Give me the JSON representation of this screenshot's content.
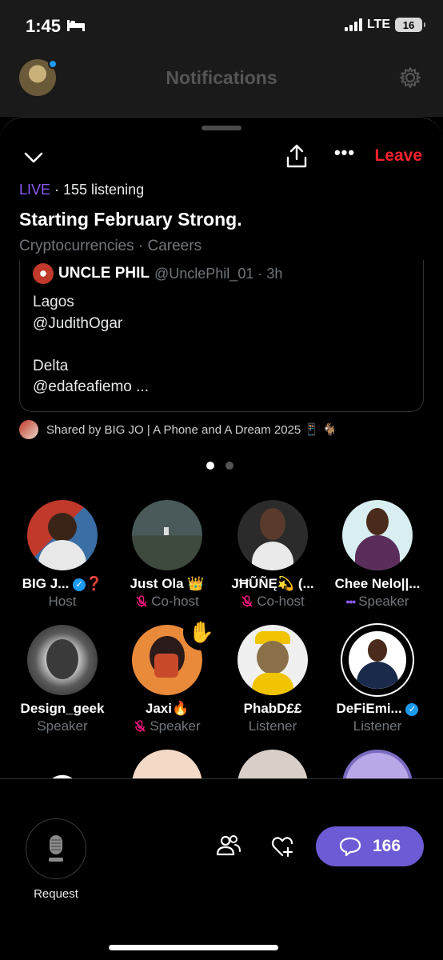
{
  "status_bar": {
    "time": "1:45",
    "network": "LTE",
    "battery": "16"
  },
  "header": {
    "title": "Notifications"
  },
  "space": {
    "leave_label": "Leave",
    "live_label": "LIVE",
    "listening_text": " · 155 listening",
    "title": "Starting February Strong.",
    "topics": "Cryptocurrencies · Careers"
  },
  "tweet": {
    "name": "UNCLE PHIL",
    "handle": "@UnclePhil_01 · 3h",
    "lines": [
      "Lagos",
      "@JudithOgar",
      "",
      "Delta",
      "@edafeafiemo ..."
    ]
  },
  "shared_by": "Shared by BIG JO | A Phone and A Dream 2025 📱 🐐",
  "participants": [
    {
      "name": "BIG J... ",
      "name_suffix": "❓",
      "role": "Host",
      "colors": [
        "#c0392b",
        "#3a6ea5"
      ]
    },
    {
      "name": "Just Ola 👑",
      "role": "Co-host",
      "colors": [
        "#3d4a3d",
        "#7c8a7a"
      ]
    },
    {
      "name": "JĦŨÑĘ💫 (...",
      "role": "Co-host",
      "colors": [
        "#2a2a2a",
        "#8a8a8a"
      ]
    },
    {
      "name": "Chee Nelo||...",
      "role": "Speaker",
      "colors": [
        "#5a2d5a",
        "#d8eef0"
      ]
    },
    {
      "name": "Design_geek",
      "role": "Speaker",
      "colors": [
        "#1a1a1a",
        "#bdbdbd"
      ]
    },
    {
      "name": "Jaxi🔥",
      "role": "Speaker",
      "colors": [
        "#c94a2a",
        "#e88a3a"
      ]
    },
    {
      "name": "PhabD££",
      "role": "Listener",
      "colors": [
        "#6a5a3a",
        "#e0d8c8"
      ]
    },
    {
      "name": "DeFiEmi...",
      "role": "Listener",
      "colors": [
        "#1a2a4a",
        "#f0f0f0"
      ]
    }
  ],
  "bottom_bar": {
    "request_label": "Request",
    "comments_count": "166"
  },
  "colors": {
    "accent": "#8b5cf6",
    "leave": "#f4212e",
    "comments": "#6b5bd4",
    "verified": "#1d9bf0"
  }
}
